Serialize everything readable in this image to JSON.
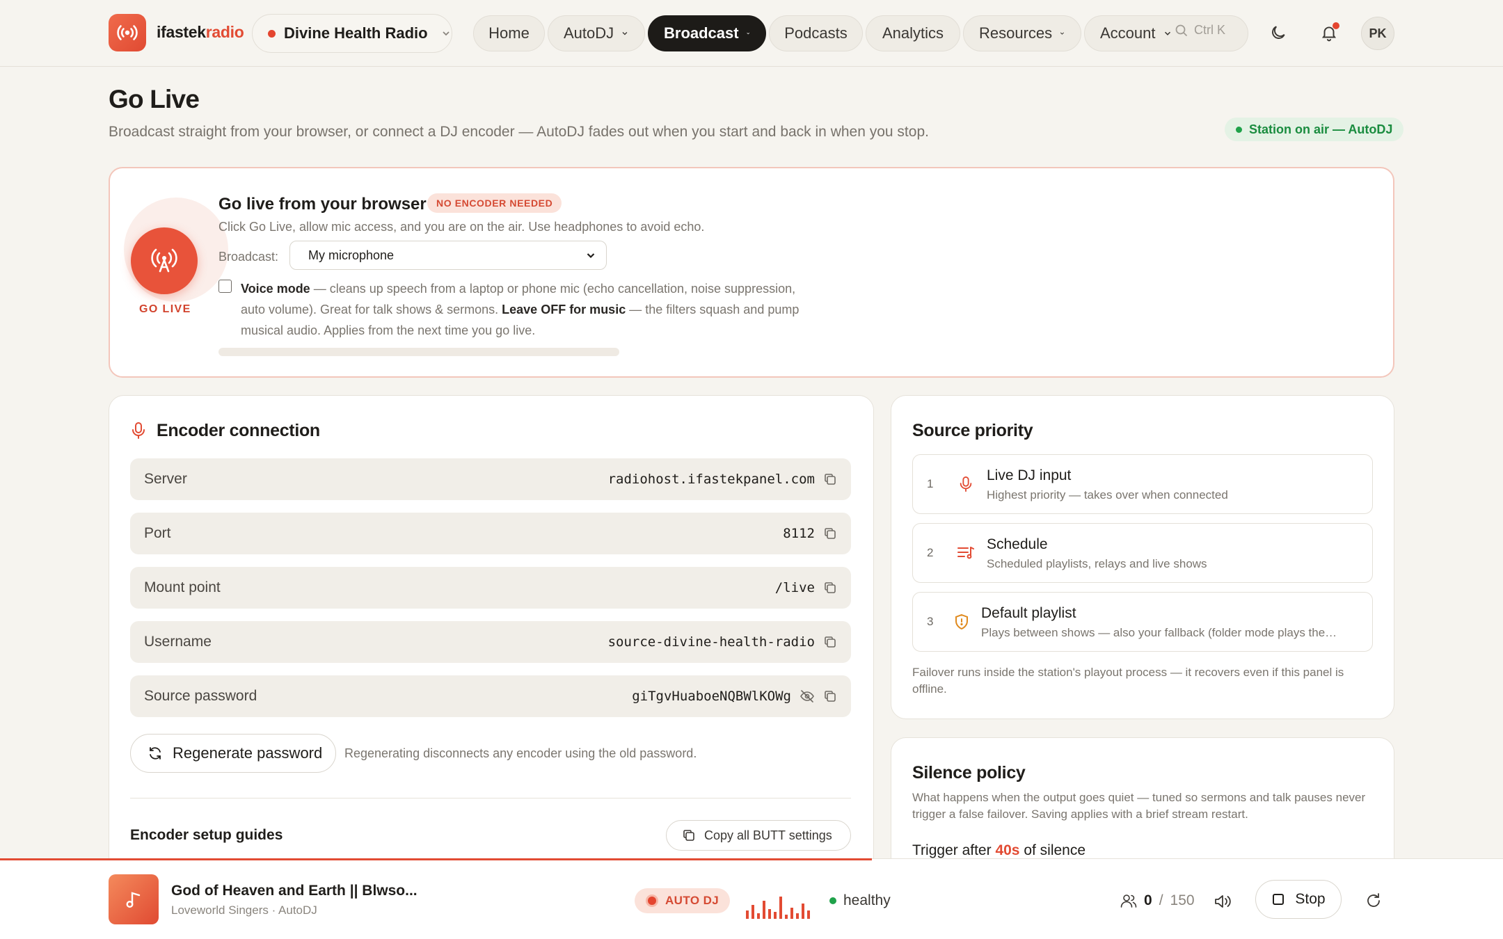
{
  "header": {
    "brand_main": "ifastek",
    "brand_accent": "radio",
    "station": "Divine Health Radio",
    "nav": [
      {
        "label": "Home",
        "dropdown": false
      },
      {
        "label": "AutoDJ",
        "dropdown": true
      },
      {
        "label": "Broadcast",
        "dropdown": true,
        "active": true
      },
      {
        "label": "Podcasts",
        "dropdown": false
      },
      {
        "label": "Analytics",
        "dropdown": false
      },
      {
        "label": "Resources",
        "dropdown": true
      },
      {
        "label": "Account",
        "dropdown": true
      }
    ],
    "search_shortcut": "Ctrl K",
    "avatar_initials": "PK"
  },
  "page": {
    "title": "Go Live",
    "subtitle": "Broadcast straight from your browser, or connect a DJ encoder — AutoDJ fades out when you start and back in when you stop.",
    "status": "Station on air — AutoDJ"
  },
  "golive": {
    "button_label": "GO LIVE",
    "title": "Go live from your browser",
    "badge": "NO ENCODER NEEDED",
    "description": "Click Go Live, allow mic access, and you are on the air. Use headphones to avoid echo.",
    "broadcast_label": "Broadcast:",
    "broadcast_value": "My microphone",
    "voice_mode_checked": false,
    "voice_mode_label": "Voice mode",
    "voice_mode_text1": " — cleans up speech from a laptop or phone mic (echo cancellation, noise suppression, auto volume). Great for talk shows & sermons. ",
    "voice_mode_bold2": "Leave OFF for music",
    "voice_mode_text2": " — the filters squash and pump musical audio. Applies from the next time you go live.",
    "mic_level": 0
  },
  "encoder": {
    "title": "Encoder connection",
    "rows": [
      {
        "key": "Server",
        "value": "radiohost.ifastekpanel.com"
      },
      {
        "key": "Port",
        "value": "8112"
      },
      {
        "key": "Mount point",
        "value": "/live"
      },
      {
        "key": "Username",
        "value": "source-divine-health-radio"
      },
      {
        "key": "Source password",
        "value": "giTgvHuaboeNQBWlKOWg"
      }
    ],
    "regen_label": "Regenerate password",
    "regen_note": "Regenerating disconnects any encoder using the old password.",
    "guides_title": "Encoder setup guides",
    "copy_butt_label": "Copy all BUTT settings"
  },
  "source_priority": {
    "title": "Source priority",
    "items": [
      {
        "num": "1",
        "name": "Live DJ input",
        "desc": "Highest priority — takes over when connected",
        "icon": "microphone-icon"
      },
      {
        "num": "2",
        "name": "Schedule",
        "desc": "Scheduled playlists, relays and live shows",
        "icon": "schedule-list-icon"
      },
      {
        "num": "3",
        "name": "Default playlist",
        "desc": "Plays between shows — also your fallback (folder mode plays the…",
        "icon": "shield-icon"
      }
    ],
    "note": "Failover runs inside the station's playout process — it recovers even if this panel is offline."
  },
  "silence": {
    "title": "Silence policy",
    "description": "What happens when the output goes quiet — tuned so sermons and talk pauses never trigger a false failover. Saving applies with a brief stream restart.",
    "trigger_prefix": "Trigger after ",
    "trigger_value": "40s",
    "trigger_suffix": " of silence"
  },
  "player": {
    "title": "God of Heaven and Earth || Blwso...",
    "artist": "Loveworld Singers · AutoDJ",
    "badge": "AUTO DJ",
    "health": "healthy",
    "listeners": "0",
    "sep": "/",
    "max_listeners": "150",
    "stop_label": "Stop",
    "progress": 0.58
  },
  "colors": {
    "accent": "#e24b33",
    "success": "#1fa24a",
    "dark": "#1d1b18"
  }
}
